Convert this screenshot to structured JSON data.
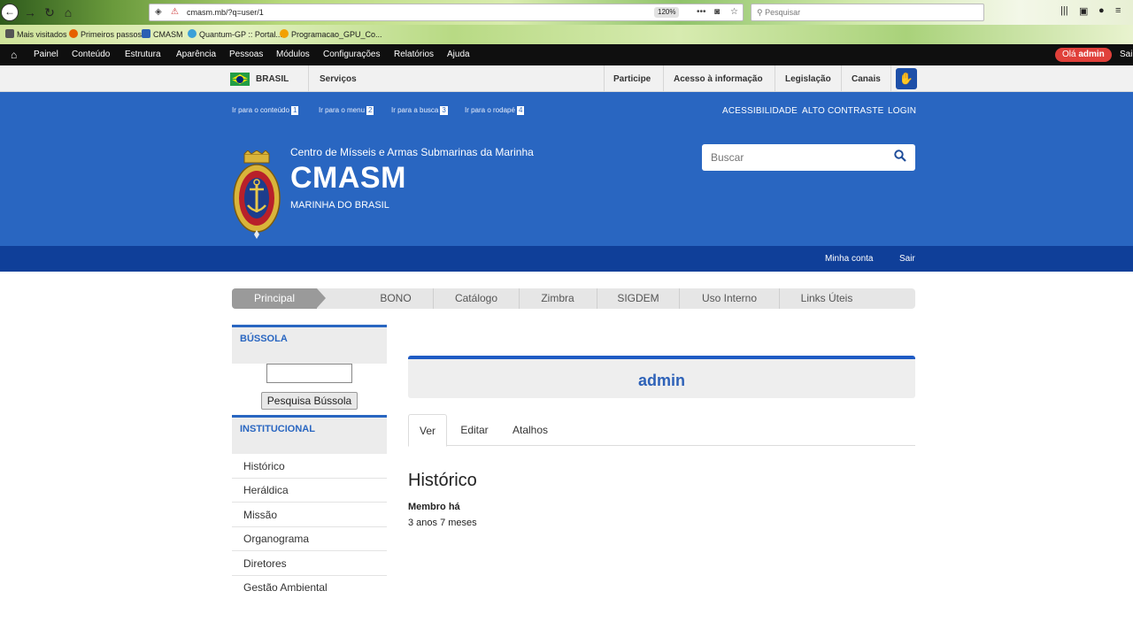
{
  "browser": {
    "url": "cmasm.mb/?q=user/1",
    "zoom": "120%",
    "search_placeholder": "Pesquisar",
    "bookmarks": [
      "Mais visitados",
      "Primeiros passos",
      "CMASM",
      "Quantum-GP :: Portal...",
      "Programacao_GPU_Co..."
    ]
  },
  "admin_toolbar": {
    "items": [
      "Painel",
      "Conteúdo",
      "Estrutura",
      "Aparência",
      "Pessoas",
      "Módulos",
      "Configurações",
      "Relatórios",
      "Ajuda"
    ],
    "hello_prefix": "Olá",
    "hello_user": "admin",
    "logout": "Sair"
  },
  "gov_bar": {
    "country": "BRASIL",
    "services": "Serviços",
    "links": [
      "Participe",
      "Acesso à informação",
      "Legislação",
      "Canais"
    ]
  },
  "header": {
    "skip_links": [
      {
        "label": "Ir para o conteúdo",
        "key": "1"
      },
      {
        "label": "Ir para o menu",
        "key": "2"
      },
      {
        "label": "Ir para a busca",
        "key": "3"
      },
      {
        "label": "Ir para o rodapé",
        "key": "4"
      }
    ],
    "accessibility_links": [
      "ACESSIBILIDADE",
      "ALTO CONTRASTE",
      "LOGIN"
    ],
    "subtitle": "Centro de Mísseis e Armas Submarinas da Marinha",
    "site_name": "CMASM",
    "org": "MARINHA DO BRASIL",
    "search_placeholder": "Buscar"
  },
  "user_bar": {
    "my_account": "Minha conta",
    "logout": "Sair"
  },
  "main_menu": {
    "active": "Principal",
    "items": [
      "BONO",
      "Catálogo",
      "Zimbra",
      "SIGDEM",
      "Uso Interno",
      "Links Úteis"
    ]
  },
  "sidebar": {
    "bussola": {
      "title": "BÚSSOLA",
      "button": "Pesquisa Bússola"
    },
    "institucional": {
      "title": "INSTITUCIONAL",
      "items": [
        "Histórico",
        "Heráldica",
        "Missão",
        "Organograma",
        "Diretores",
        "Gestão Ambiental"
      ]
    }
  },
  "profile": {
    "name": "admin",
    "tabs": [
      "Ver",
      "Editar",
      "Atalhos"
    ],
    "active_tab": "Ver",
    "section_title": "Histórico",
    "member_label": "Membro há",
    "member_value": "3 anos 7 meses"
  },
  "colors": {
    "header_blue": "#2966c1",
    "user_bar_blue": "#0f3f99",
    "accent_red": "#e0403a"
  }
}
